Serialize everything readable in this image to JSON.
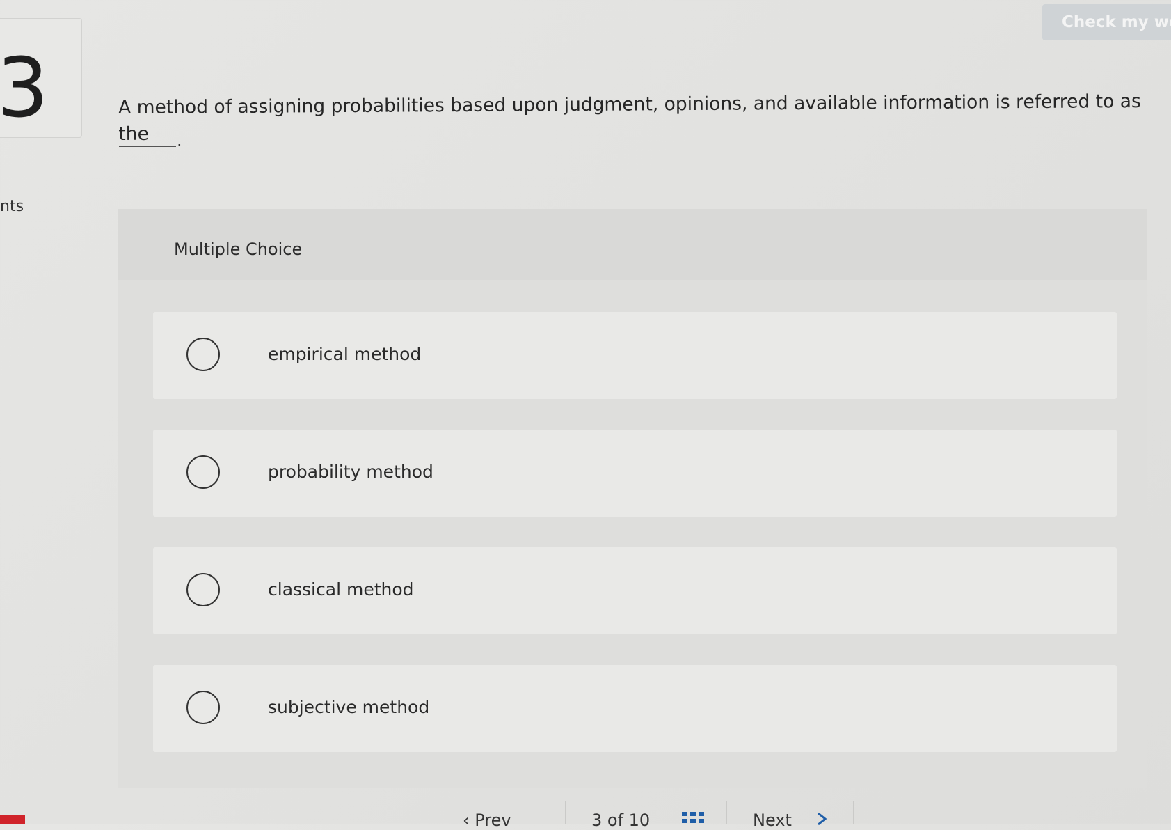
{
  "question": {
    "number": "3",
    "points_label": "nts",
    "prompt": "A method of assigning probabilities based upon judgment, opinions, and available information is referred to as the",
    "blank_suffix": "."
  },
  "header": {
    "check_work_label": "Check my wo"
  },
  "multiple_choice": {
    "title": "Multiple Choice",
    "options": [
      {
        "label": "empirical method"
      },
      {
        "label": "probability method"
      },
      {
        "label": "classical method"
      },
      {
        "label": "subjective method"
      }
    ]
  },
  "navigation": {
    "prev_label": "‹ Prev",
    "page_indicator": "3 of 10",
    "next_label": "Next",
    "grid_icon": "grid-icon",
    "next_icon": "chevron-right-icon"
  },
  "colors": {
    "accent_red": "#d0232a",
    "nav_blue": "#1f5ea8",
    "check_button_bg": "#cfd3d6"
  }
}
